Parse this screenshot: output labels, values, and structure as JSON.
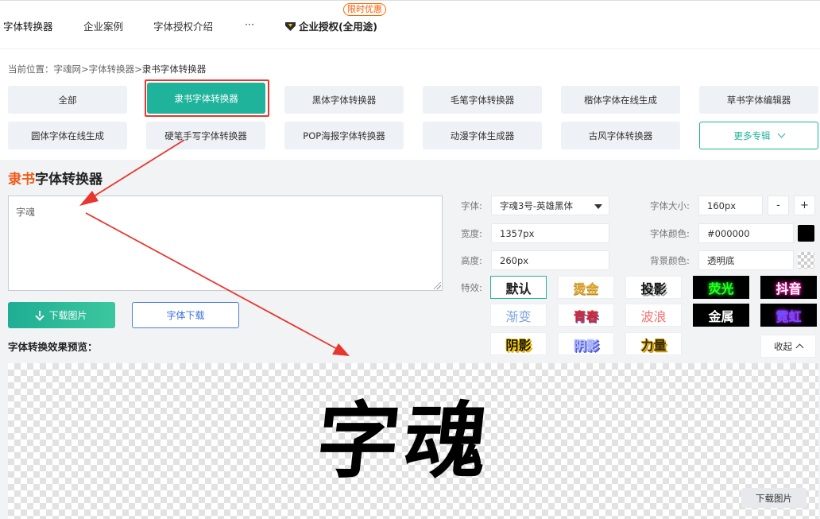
{
  "nav": {
    "items": [
      "字体转换器",
      "企业案例",
      "字体授权介绍",
      "···"
    ],
    "enterprise_label": "企业授权(全用途)",
    "promo_badge": "限时优惠"
  },
  "breadcrumb": {
    "prefix": "当前位置：",
    "path": "字魂网>字体转换器>",
    "current": "隶书字体转换器"
  },
  "categories": [
    "全部",
    "隶书字体转换器",
    "黑体字体转换器",
    "毛笔字体转换器",
    "楷体字体在线生成",
    "草书字体编辑器",
    "圆体字体在线生成",
    "硬笔手写字体转换器",
    "POP海报字体转换器",
    "动漫字体生成器",
    "古风字体转换器",
    "更多专辑"
  ],
  "panel": {
    "title_accent": "隶书",
    "title_rest": "字体转换器",
    "text_value": "字魂",
    "download_image": "下载图片",
    "font_download": "字体下载",
    "preview_label": "字体转换效果预览："
  },
  "settings": {
    "font_label": "字体:",
    "font_value": "字魂3号-英雄黑体",
    "width_label": "宽度:",
    "width_value": "1357px",
    "height_label": "高度:",
    "height_value": "260px",
    "size_label": "字体大小:",
    "size_value": "160px",
    "minus": "-",
    "plus": "+",
    "color_label": "字体颜色:",
    "color_value": "#000000",
    "bg_label": "背景颜色:",
    "bg_value": "透明底",
    "effects_label": "特效:",
    "collapse": "收起"
  },
  "effects": [
    "默认",
    "烫金",
    "投影",
    "荧光",
    "抖音",
    "渐变",
    "青春",
    "波浪",
    "金属",
    "霓虹",
    "阴影",
    "阴影",
    "力量"
  ],
  "preview": {
    "text": "字魂",
    "download": "下载图片"
  },
  "colors": {
    "accent": "#1fb39b",
    "title_accent": "#f25a1a",
    "highlight_box": "#e8362f"
  }
}
